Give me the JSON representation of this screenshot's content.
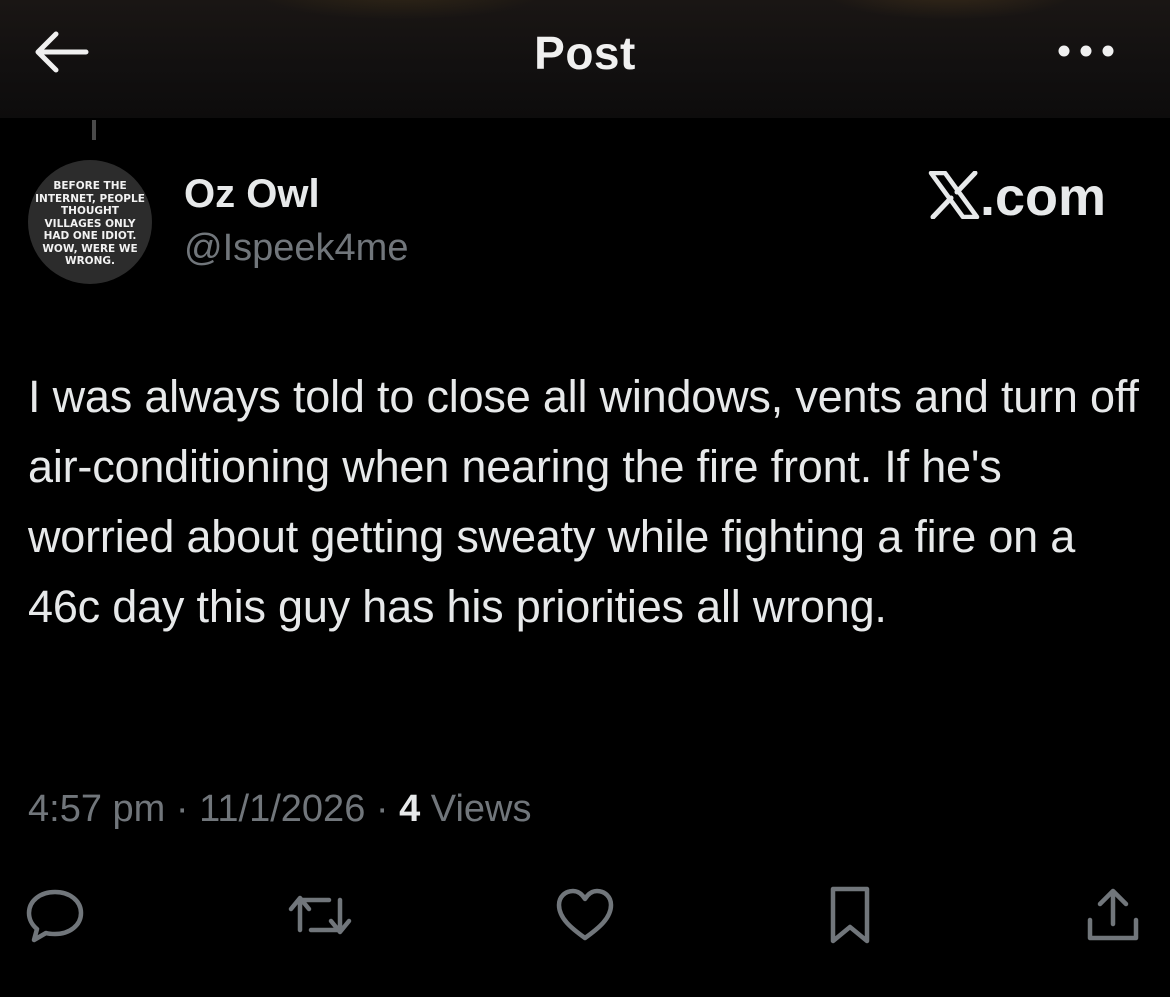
{
  "header": {
    "title": "Post",
    "back_icon": "arrow-left-icon",
    "more_icon": "more-horizontal-icon"
  },
  "author": {
    "avatar_text": "BEFORE THE INTERNET, PEOPLE THOUGHT VILLAGES ONLY HAD ONE IDIOT. WOW, WERE WE WRONG.",
    "display_name": "Oz Owl",
    "handle": "@Ispeek4me"
  },
  "watermark": ".com",
  "post": {
    "text": "I was always told to close all windows, vents and turn off air-conditioning when nearing the fire front. If he's worried about getting sweaty while fighting a fire on a 46c day this guy has his priorities all wrong.",
    "time": "4:57 pm",
    "separator": " · ",
    "date": "11/1/2026",
    "views_count": "4",
    "views_label": " Views"
  },
  "actions": [
    {
      "name": "reply",
      "icon": "reply-icon"
    },
    {
      "name": "repost",
      "icon": "repost-icon"
    },
    {
      "name": "like",
      "icon": "heart-icon"
    },
    {
      "name": "bookmark",
      "icon": "bookmark-icon"
    },
    {
      "name": "share",
      "icon": "share-icon"
    }
  ],
  "colors": {
    "background": "#000000",
    "primary_text": "#e7e9ea",
    "secondary_text": "#71767b"
  }
}
